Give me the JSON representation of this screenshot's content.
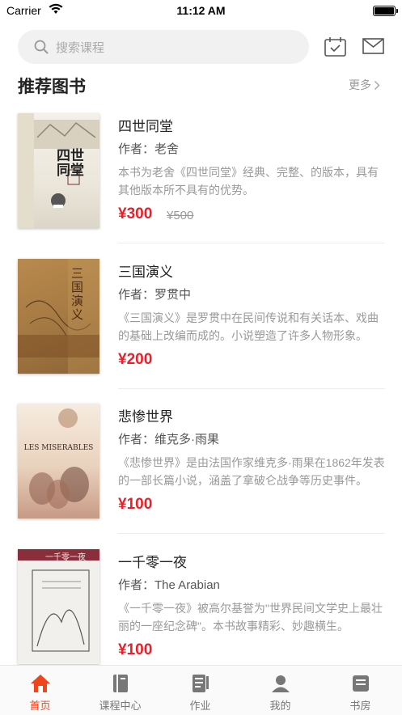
{
  "status_bar": {
    "carrier": "Carrier",
    "time": "11:12 AM"
  },
  "search": {
    "placeholder": "搜索课程"
  },
  "section": {
    "title": "推荐图书",
    "more": "更多"
  },
  "books": [
    {
      "title": "四世同堂",
      "author": "作者：老舍",
      "description": "本书为老舍《四世同堂》经典、完整、的版本，具有其他版本所不具有的优势。",
      "price": "¥300",
      "original_price": "¥500",
      "cover_text": "四世同堂"
    },
    {
      "title": "三国演义",
      "author": "作者：罗贯中",
      "description": "《三国演义》是罗贯中在民间传说和有关话本、戏曲的基础上改编而成的。小说塑造了许多人物形象。",
      "price": "¥200",
      "original_price": "",
      "cover_text": "三国演义"
    },
    {
      "title": "悲惨世界",
      "author": "作者：维克多·雨果",
      "description": "《悲惨世界》是由法国作家维克多·雨果在1862年发表的一部长篇小说，涵盖了拿破仑战争等历史事件。",
      "price": "¥100",
      "original_price": "",
      "cover_text": "LES MISERABLES"
    },
    {
      "title": "一千零一夜",
      "author": "作者：The Arabian",
      "description": "《一千零一夜》被高尔基誉为\"世界民间文学史上最壮丽的一座纪念碑\"。本书故事精彩、妙趣横生。",
      "price": "¥100",
      "original_price": "",
      "cover_text": "一千零一夜"
    }
  ],
  "tabs": [
    {
      "label": "首页",
      "icon": "home-icon",
      "active": true
    },
    {
      "label": "课程中心",
      "icon": "book-icon",
      "active": false
    },
    {
      "label": "作业",
      "icon": "homework-icon",
      "active": false
    },
    {
      "label": "我的",
      "icon": "profile-icon",
      "active": false
    },
    {
      "label": "书房",
      "icon": "study-icon",
      "active": false
    }
  ],
  "colors": {
    "accent": "#e8202a",
    "tab_active": "#f0441c",
    "text_muted": "#999999"
  }
}
